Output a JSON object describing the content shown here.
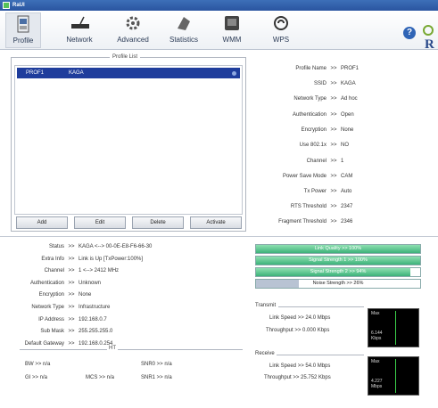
{
  "window": {
    "title": "RaUI"
  },
  "toolbar": {
    "items": [
      {
        "label": "Profile",
        "icon": "profile-icon"
      },
      {
        "label": "Network",
        "icon": "network-icon"
      },
      {
        "label": "Advanced",
        "icon": "advanced-icon"
      },
      {
        "label": "Statistics",
        "icon": "statistics-icon"
      },
      {
        "label": "WMM",
        "icon": "wmm-icon"
      },
      {
        "label": "WPS",
        "icon": "wps-icon"
      }
    ],
    "help": "?"
  },
  "profile_list": {
    "title": "Profile List",
    "rows": [
      {
        "name": "PROF1",
        "ssid": "KAGA"
      }
    ],
    "buttons": {
      "add": "Add",
      "edit": "Edit",
      "delete": "Delete",
      "activate": "Activate"
    }
  },
  "profile_details": [
    {
      "key": "Profile Name",
      "value": "PROF1"
    },
    {
      "key": "SSID",
      "value": "KAGA"
    },
    {
      "key": "Network Type",
      "value": "Ad hoc"
    },
    {
      "key": "Authentication",
      "value": "Open"
    },
    {
      "key": "Encryption",
      "value": "None"
    },
    {
      "key": "Use 802.1x",
      "value": "NO"
    },
    {
      "key": "Channel",
      "value": "1"
    },
    {
      "key": "Power Save Mode",
      "value": "CAM"
    },
    {
      "key": "Tx Power",
      "value": "Auto"
    },
    {
      "key": "RTS Threshold",
      "value": "2347"
    },
    {
      "key": "Fragment Threshold",
      "value": "2346"
    }
  ],
  "status": [
    {
      "key": "Status",
      "value": "KAGA  <--> 00-0E-E8-F6-66-30"
    },
    {
      "key": "Extra Info",
      "value": "Link is Up [TxPower:100%]"
    },
    {
      "key": "Channel",
      "value": "1 <--> 2412 MHz"
    },
    {
      "key": "Authentication",
      "value": "Unknown"
    },
    {
      "key": "Encryption",
      "value": "None"
    },
    {
      "key": "Network Type",
      "value": "Infrastructure"
    },
    {
      "key": "IP Address",
      "value": "192.168.0.7"
    },
    {
      "key": "Sub Mask",
      "value": "255.255.255.0"
    },
    {
      "key": "Default Gateway",
      "value": "192.168.0.254"
    }
  ],
  "ht": {
    "title": "HT",
    "bw": "BW >> n/a",
    "gi": "GI >> n/a",
    "mcs": "MCS >> n/a",
    "snr0": "SNR0 >> n/a",
    "snr1": "SNR1 >> n/a"
  },
  "signal": {
    "link_quality": {
      "label": "Link Quality >> 100%",
      "percent": 100
    },
    "signal1": {
      "label": "Signal Strength 1 >> 100%",
      "percent": 100
    },
    "signal2": {
      "label": "Signal Strength 2 >> 94%",
      "percent": 94
    },
    "noise": {
      "label": "Noise Strength >> 26%",
      "percent": 26
    }
  },
  "transmit": {
    "title": "Transmit",
    "link_speed": "Link Speed >> 24.0 Mbps",
    "throughput": "Throughput >> 0.000 Kbps",
    "graph_max": "Max",
    "graph_value": "6.144",
    "graph_unit": "Kbps"
  },
  "receive": {
    "title": "Receive",
    "link_speed": "Link Speed >> 54.0 Mbps",
    "throughput": "Throughput >> 25.752 Kbps",
    "graph_max": "Max",
    "graph_value": "4.227",
    "graph_unit": "Mbps"
  },
  "colors": {
    "title_bar": "#2a55a0",
    "selection": "#1f3d9c",
    "signal_fill": "#3db27a",
    "graph_line": "#3bd04a"
  }
}
